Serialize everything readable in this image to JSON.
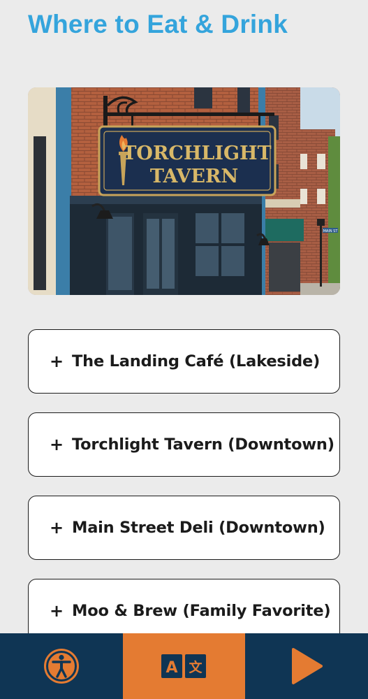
{
  "header": {
    "title": "Where to Eat & Drink"
  },
  "hero": {
    "sign_line1": "TORCHLIGHT",
    "sign_line2": "TAVERN",
    "street_sign": "MAIN ST"
  },
  "sections": [
    {
      "icon": "+",
      "label": "The Landing Café (Lakeside)"
    },
    {
      "icon": "+",
      "label": "Torchlight Tavern (Downtown)"
    },
    {
      "icon": "+",
      "label": "Main Street Deli (Downtown)"
    },
    {
      "icon": "+",
      "label": "Moo & Brew (Family Favorite)"
    }
  ],
  "bottom_bar": {
    "items": [
      {
        "name": "accessibility-button",
        "icon": "accessibility-icon"
      },
      {
        "name": "translate-button",
        "icon": "translate-icon",
        "glyph_a": "A",
        "glyph_b": "文"
      },
      {
        "name": "play-button",
        "icon": "play-icon"
      }
    ]
  },
  "colors": {
    "title": "#34a4dc",
    "bar_background": "#0f3554",
    "bar_active": "#e47b32",
    "card_border": "#1b1b1b"
  }
}
